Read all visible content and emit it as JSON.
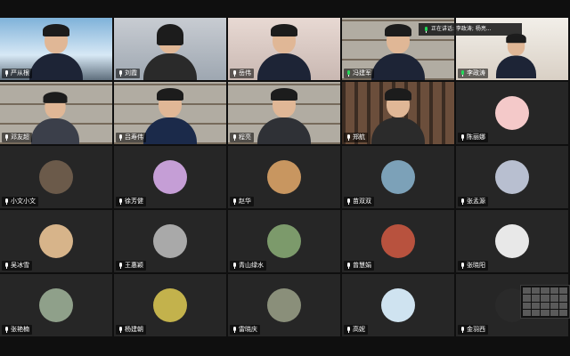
{
  "meeting": {
    "speaking_label": "正在讲话: 李政涛; 杨亮...",
    "speaking_indicator_icon": "mic-icon"
  },
  "participants": [
    {
      "name": "严从根",
      "kind": "video",
      "scene": "sky",
      "mic": "on"
    },
    {
      "name": "刘霞",
      "kind": "video",
      "scene": "room",
      "mic": "on"
    },
    {
      "name": "岳伟",
      "kind": "video",
      "scene": "room",
      "mic": "on"
    },
    {
      "name": "冯建军",
      "kind": "video",
      "scene": "shelf",
      "mic": "on"
    },
    {
      "name": "李政涛",
      "kind": "video",
      "scene": "room",
      "mic": "on",
      "speaker": true
    },
    {
      "name": "邓友超",
      "kind": "video",
      "scene": "shelf",
      "mic": "on"
    },
    {
      "name": "吕寿伟",
      "kind": "video",
      "scene": "shelf",
      "mic": "on"
    },
    {
      "name": "程亮",
      "kind": "video",
      "scene": "shelf",
      "mic": "on"
    },
    {
      "name": "郑航",
      "kind": "video",
      "scene": "bookcase",
      "mic": "on"
    },
    {
      "name": "陈丽娜",
      "kind": "avatar",
      "avatar_color": "#f4c9c9",
      "mic": "on"
    },
    {
      "name": "小文小文",
      "kind": "avatar",
      "avatar_color": "#6b5a4a",
      "mic": "on"
    },
    {
      "name": "徐芳健",
      "kind": "avatar",
      "avatar_color": "#c59ed6",
      "mic": "on"
    },
    {
      "name": "赵华",
      "kind": "avatar",
      "avatar_color": "#c89660",
      "mic": "on"
    },
    {
      "name": "苗双双",
      "kind": "avatar",
      "avatar_color": "#7ca1b8",
      "mic": "on"
    },
    {
      "name": "张孟源",
      "kind": "avatar",
      "avatar_color": "#b8bfd0",
      "mic": "on"
    },
    {
      "name": "吴冰雪",
      "kind": "avatar",
      "avatar_color": "#d7b48a",
      "mic": "on"
    },
    {
      "name": "王惠颖",
      "kind": "avatar",
      "avatar_color": "#a9a9a9",
      "mic": "on"
    },
    {
      "name": "青山绿水",
      "kind": "avatar",
      "avatar_color": "#7c9a6b",
      "mic": "on"
    },
    {
      "name": "曾慧娟",
      "kind": "avatar",
      "avatar_color": "#b8523e",
      "mic": "on"
    },
    {
      "name": "张晓阳",
      "kind": "avatar",
      "avatar_color": "#e8e8e8",
      "mic": "on"
    },
    {
      "name": "张艳楠",
      "kind": "avatar",
      "avatar_color": "#8fa08a",
      "mic": "on"
    },
    {
      "name": "杨建朝",
      "kind": "avatar",
      "avatar_color": "#c3b24c",
      "mic": "on"
    },
    {
      "name": "雷晓庆",
      "kind": "avatar",
      "avatar_color": "#8a8f7a",
      "mic": "on"
    },
    {
      "name": "高妮",
      "kind": "avatar",
      "avatar_color": "#cfe3f0",
      "mic": "on"
    },
    {
      "name": "金羽西",
      "kind": "avatar",
      "avatar_color": "#2a2a2a",
      "mic": "on"
    }
  ],
  "self_view": {
    "label": ""
  }
}
